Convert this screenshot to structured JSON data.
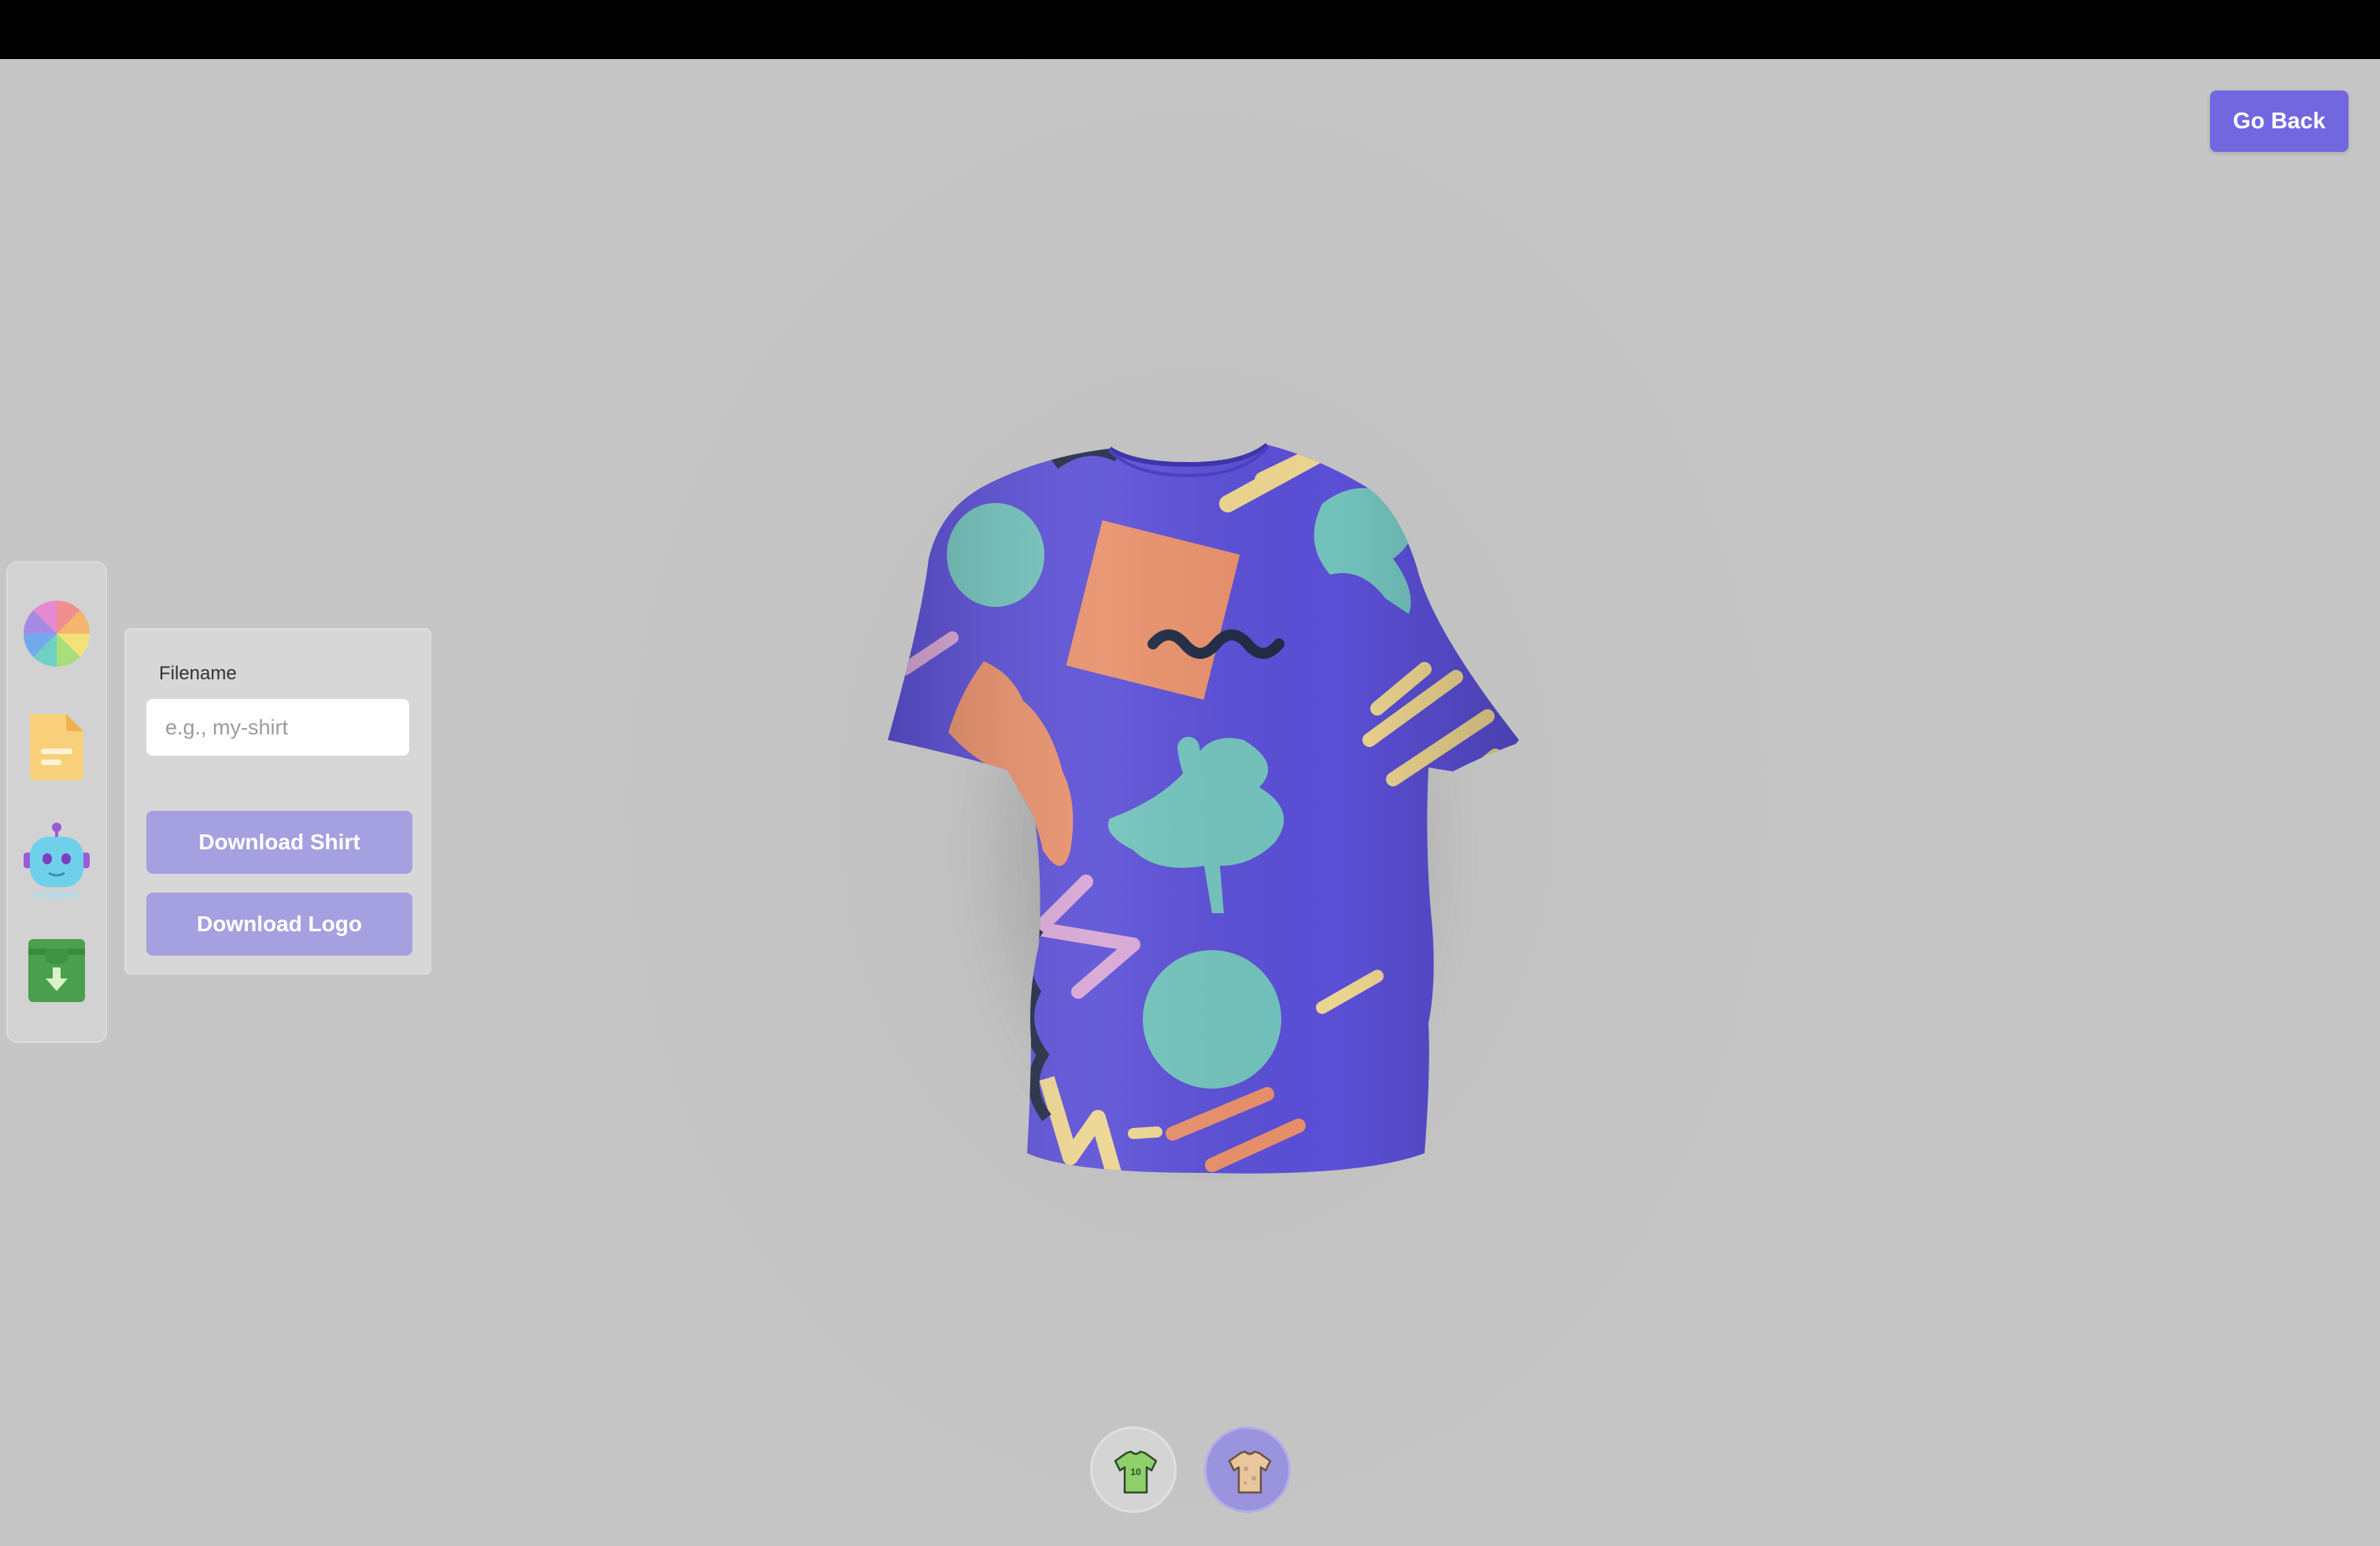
{
  "header": {
    "go_back_label": "Go Back"
  },
  "tools": [
    {
      "name": "color-picker",
      "icon": "color-wheel-icon"
    },
    {
      "name": "file-picker",
      "icon": "file-icon"
    },
    {
      "name": "ai-picker",
      "icon": "robot-icon"
    },
    {
      "name": "download",
      "icon": "download-box-icon"
    }
  ],
  "download_panel": {
    "filename_label": "Filename",
    "filename_value": "",
    "filename_placeholder": "e.g., my-shirt",
    "download_shirt_label": "Download Shirt",
    "download_logo_label": "Download Logo"
  },
  "filters": {
    "logo_shirt_badge": "10",
    "active_filter": "full-shirt"
  },
  "colors": {
    "accent": "#7367e0",
    "shirt": "#5b4fd6",
    "pattern_teal": "#72c2bc",
    "pattern_orange": "#e8906a",
    "pattern_yellow": "#ecd58f",
    "pattern_pink": "#d7a6d4",
    "pattern_navy": "#1f2a44"
  }
}
